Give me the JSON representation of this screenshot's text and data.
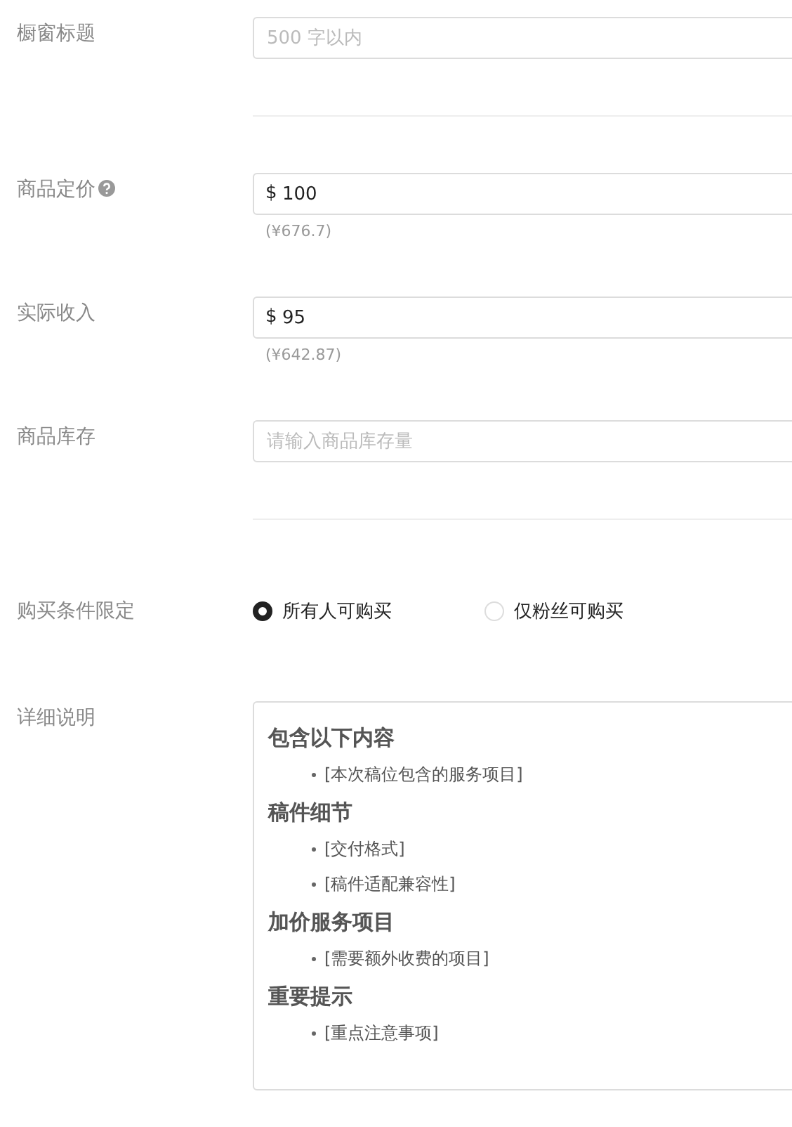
{
  "fields": [
    {
      "kind": "input",
      "label": "橱窗标题",
      "placeholder": "500 字以内"
    },
    {
      "kind": "money",
      "label": "商品定价",
      "help": true,
      "currency": "$",
      "value": "100",
      "converted": "(¥676.7)"
    },
    {
      "kind": "money",
      "label": "实际收入",
      "help": false,
      "currency": "$",
      "value": "95",
      "converted": "(¥642.87)"
    },
    {
      "kind": "input",
      "label": "商品库存",
      "placeholder": "请输入商品库存量"
    },
    {
      "kind": "radio",
      "label": "购买条件限定",
      "options": [
        {
          "label": "所有人可购买",
          "selected": true
        },
        {
          "label": "仅粉丝可购买",
          "selected": false
        }
      ]
    },
    {
      "kind": "editor",
      "label": "详细说明",
      "sections": [
        {
          "heading": "包含以下内容",
          "items": [
            "[本次稿位包含的服务项目]"
          ]
        },
        {
          "heading": "稿件细节",
          "items": [
            "[交付格式]",
            "[稿件适配兼容性]"
          ]
        },
        {
          "heading": "加价服务项目",
          "items": [
            "[需要额外收费的项目]"
          ]
        },
        {
          "heading": "重要提示",
          "items": [
            "[重点注意事项]"
          ]
        }
      ]
    }
  ]
}
